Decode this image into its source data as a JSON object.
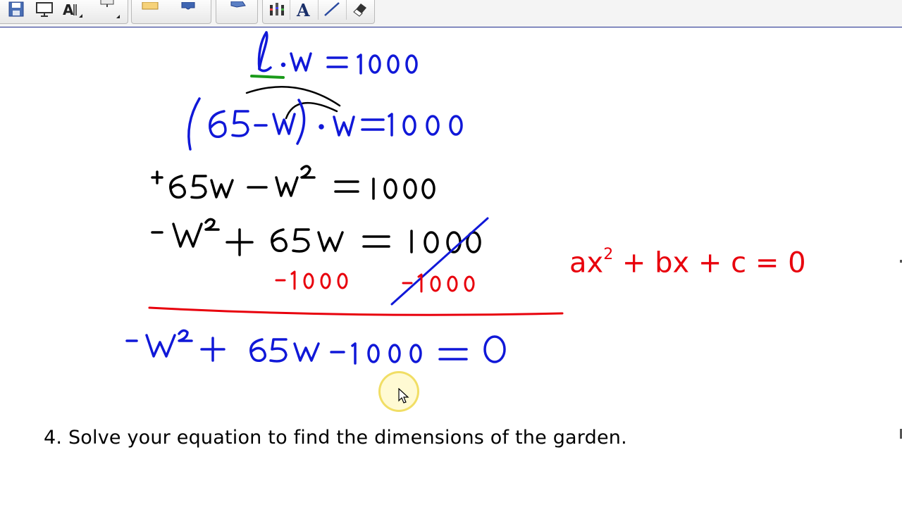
{
  "toolbar": {
    "buttons": [
      {
        "name": "save-icon"
      },
      {
        "name": "screen-shade-icon"
      },
      {
        "name": "spell-text-icon"
      },
      {
        "name": "display-icon"
      },
      {
        "name": "envelope-icon"
      },
      {
        "name": "puzzle-icon"
      },
      {
        "name": "table-icon"
      },
      {
        "name": "pens-icon"
      },
      {
        "name": "text-tool-icon"
      },
      {
        "name": "line-tool-icon"
      },
      {
        "name": "eraser-icon"
      }
    ],
    "text_tool_glyph": "A",
    "spell_glyph": "A"
  },
  "colors": {
    "accent": "#e8000c",
    "ink_blue": "#1018d8",
    "ink_black": "#000000",
    "ink_green": "#1a9a1a",
    "toolbar_border": "#1c2a8c"
  },
  "canvas": {
    "handwriting": [
      {
        "text": "l · w = 1000"
      },
      {
        "text": "(65 - w) · w = 1000"
      },
      {
        "text": "+65w - w² = 1000"
      },
      {
        "text": "-w² + 65w = 1000"
      },
      {
        "text": "-1000"
      },
      {
        "text": "-1000"
      },
      {
        "text": "-w² + 65w - 1000 = 0"
      }
    ],
    "standard_form": {
      "a": "ax",
      "exp": "2",
      "rest": " + bx + c = 0"
    },
    "question": "4. Solve your equation to find the dimensions of the garden."
  }
}
